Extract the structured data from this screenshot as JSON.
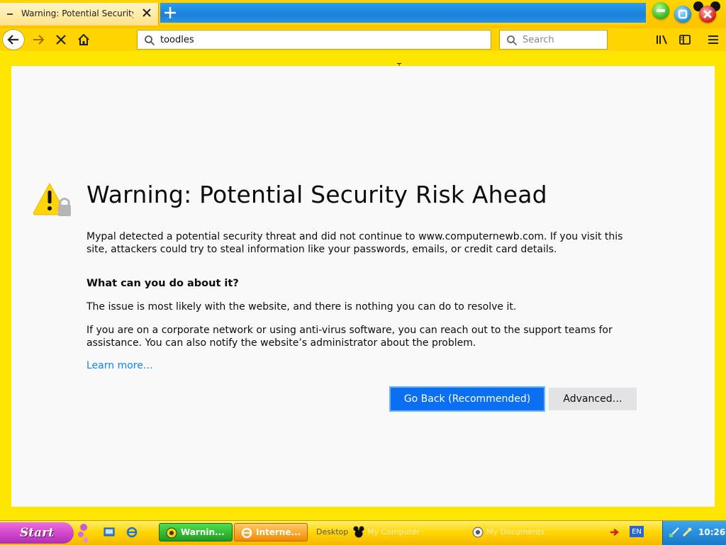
{
  "tab": {
    "title": "Warning: Potential Security R",
    "close_label": "×"
  },
  "nav": {
    "url": "toodles",
    "search_placeholder": "Search"
  },
  "page": {
    "title": "Warning: Potential Security Risk Ahead",
    "intro": "Mypal detected a potential security threat and did not continue to www.computernewb.com. If you visit this site, attackers could try to steal information like your passwords, emails, or credit card details.",
    "what_heading": "What can you do about it?",
    "issue": "The issue is most likely with the website, and there is nothing you can do to resolve it.",
    "corporate": "If you are on a corporate network or using anti-virus software, you can reach out to the support teams for assistance. You can also notify the website’s administrator about the problem.",
    "learn_more": "Learn more…",
    "go_back": "Go Back (Recommended)",
    "advanced": "Advanced…"
  },
  "taskbar": {
    "start": "Start",
    "tasks": [
      {
        "label": "Warnin..."
      },
      {
        "label": "Interne..."
      }
    ],
    "desktop": "Desktop",
    "my_computer": "My Computer",
    "my_documents": "My Documents",
    "lang": "EN",
    "clock": "10:26"
  },
  "colors": {
    "chrome": "#ffd400",
    "primary_button": "#0a6ff0",
    "link": "#0a84ff"
  }
}
